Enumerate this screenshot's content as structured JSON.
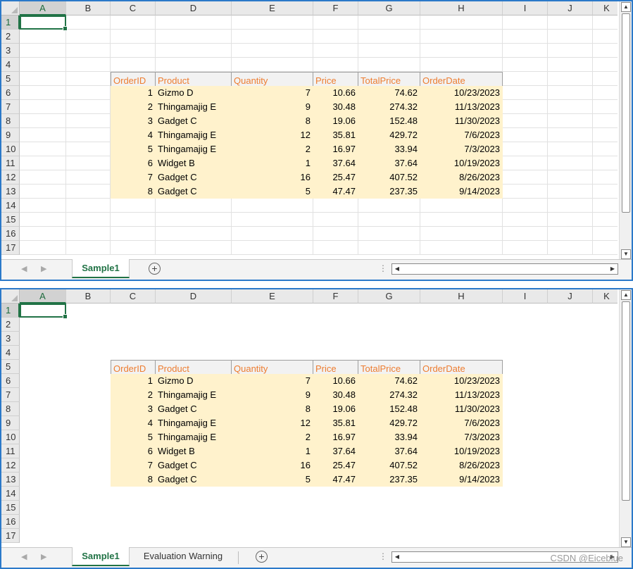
{
  "columns": [
    "A",
    "B",
    "C",
    "D",
    "E",
    "F",
    "G",
    "H",
    "I",
    "J",
    "K"
  ],
  "rows": [
    "1",
    "2",
    "3",
    "4",
    "5",
    "6",
    "7",
    "8",
    "9",
    "10",
    "11",
    "12",
    "13",
    "14",
    "15",
    "16",
    "17"
  ],
  "table": {
    "headers": [
      "OrderID",
      "Product",
      "Quantity",
      "Price",
      "TotalPrice",
      "OrderDate"
    ],
    "rows": [
      [
        "1",
        "Gizmo D",
        "7",
        "10.66",
        "74.62",
        "10/23/2023"
      ],
      [
        "2",
        "Thingamajig E",
        "9",
        "30.48",
        "274.32",
        "11/13/2023"
      ],
      [
        "3",
        "Gadget C",
        "8",
        "19.06",
        "152.48",
        "11/30/2023"
      ],
      [
        "4",
        "Thingamajig E",
        "12",
        "35.81",
        "429.72",
        "7/6/2023"
      ],
      [
        "5",
        "Thingamajig E",
        "2",
        "16.97",
        "33.94",
        "7/3/2023"
      ],
      [
        "6",
        "Widget B",
        "1",
        "37.64",
        "37.64",
        "10/19/2023"
      ],
      [
        "7",
        "Gadget C",
        "16",
        "25.47",
        "407.52",
        "8/26/2023"
      ],
      [
        "8",
        "Gadget C",
        "5",
        "47.47",
        "237.35",
        "9/14/2023"
      ]
    ]
  },
  "active_cell": "A1",
  "top_panel": {
    "gridlines": true,
    "sheet_tabs": [
      "Sample1"
    ],
    "active_tab": "Sample1"
  },
  "bottom_panel": {
    "gridlines": false,
    "sheet_tabs": [
      "Sample1",
      "Evaluation Warning"
    ],
    "active_tab": "Sample1"
  },
  "icons": {
    "add_sheet": "plus-circle-icon",
    "tab_prev": "triangle-left-icon",
    "tab_next": "triangle-right-icon",
    "scroll_up": "triangle-up-icon",
    "scroll_down": "triangle-down-icon",
    "scroll_left": "triangle-left-icon",
    "scroll_right": "triangle-right-icon",
    "splitter": "vertical-dots-icon"
  },
  "watermark": "CSDN @Eiceblue",
  "colors": {
    "panel_border": "#2b79c9",
    "header_text": "#ed7d31",
    "data_fill": "#fff2cc",
    "header_fill": "#f2f2f2",
    "selection": "#217346"
  }
}
